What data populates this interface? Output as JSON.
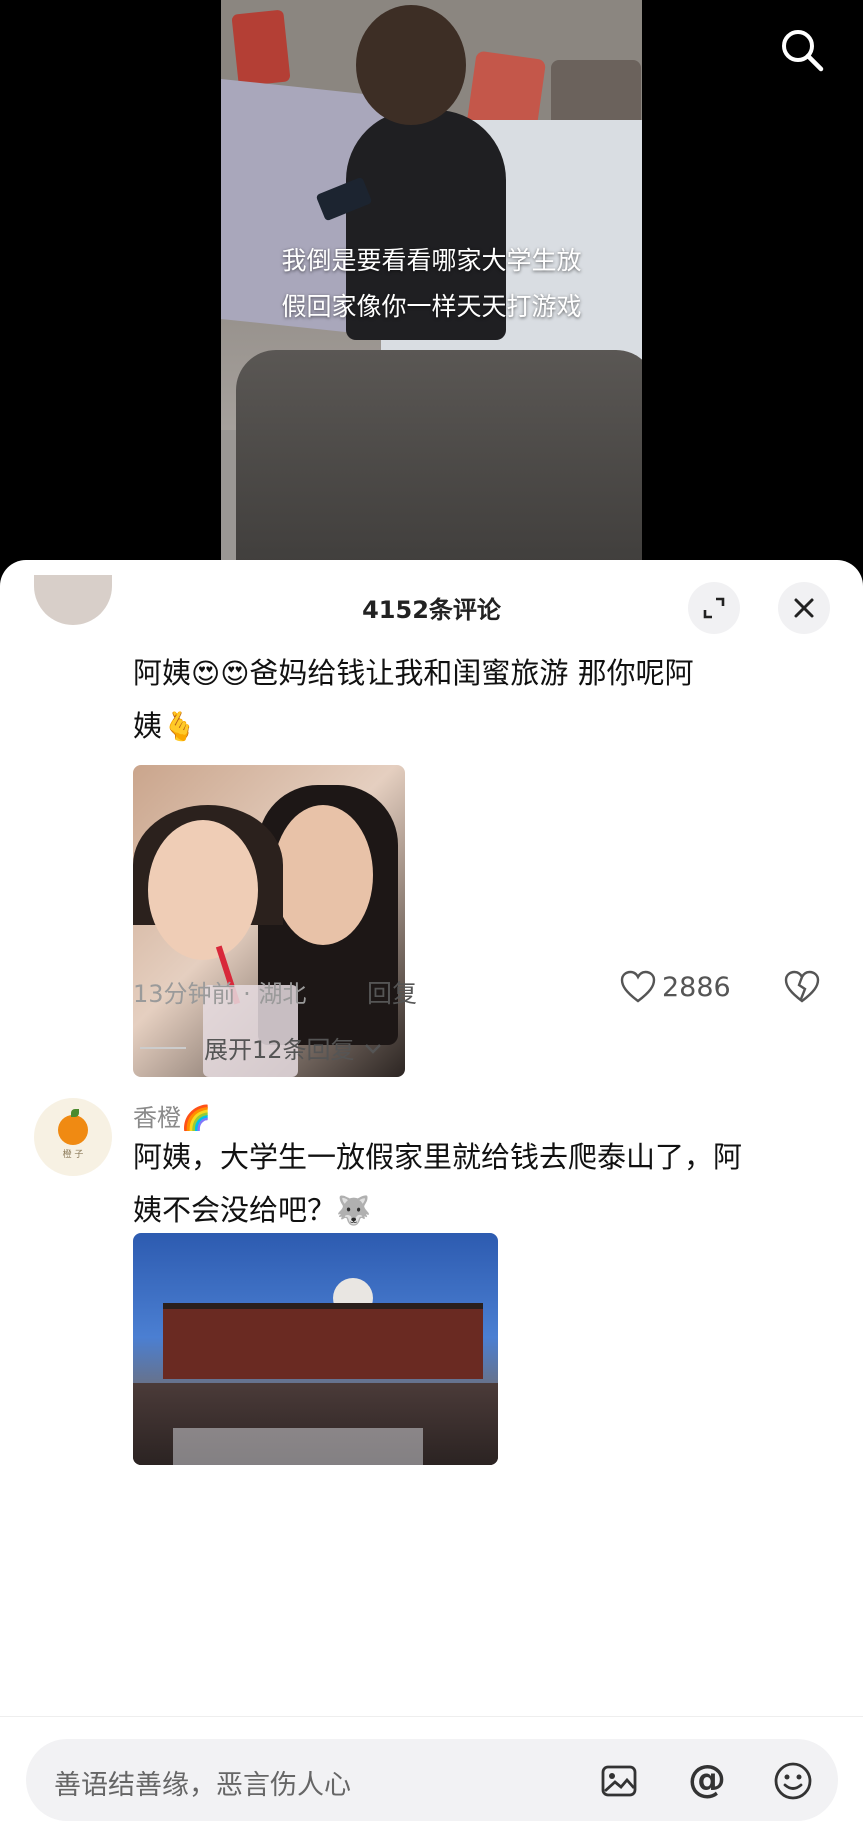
{
  "video": {
    "caption_line1": "我倒是要看看哪家大学生放",
    "caption_line2": "假回家像你一样天天打游戏"
  },
  "comments_panel": {
    "title": "4152条评论"
  },
  "comment1": {
    "text_line1": "阿姨",
    "emoji1": "😍😍",
    "text_line1b": "爸妈给钱让我和闺蜜旅游  那你呢阿",
    "text_line2": "姨",
    "emoji2": "🫰",
    "time": "13分钟前",
    "location": "湖北",
    "reply_label": "回复",
    "like_count": "2886",
    "expand_label": "展开12条回复"
  },
  "comment2": {
    "username": "香橙",
    "username_emoji": "🌈",
    "avatar_text": "橙 子",
    "text_line1": "阿姨，大学生一放假家里就给钱去爬泰山了，阿",
    "text_line2": "姨不会没给吧？",
    "emoji": "🐺"
  },
  "input": {
    "placeholder": "善语结善缘，恶言伤人心"
  },
  "colors": {
    "sheet_bg": "#ffffff",
    "text_primary": "#111111",
    "text_secondary": "#9a9a9a"
  }
}
